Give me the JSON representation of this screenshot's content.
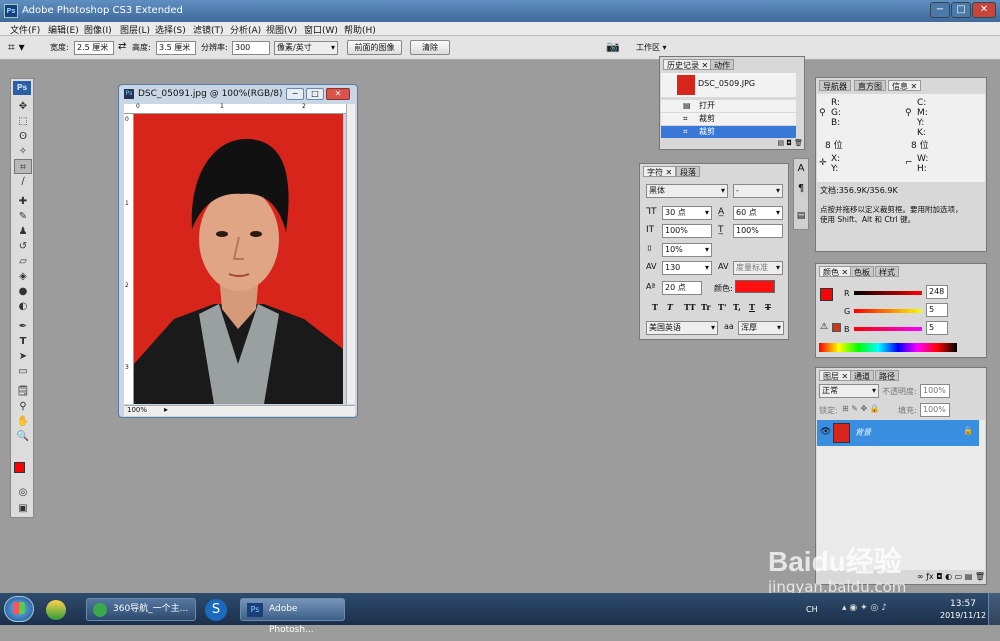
{
  "app": {
    "title": "Adobe Photoshop CS3 Extended",
    "icon": "Ps"
  },
  "menu": [
    "文件(F)",
    "编辑(E)",
    "图像(I)",
    "图层(L)",
    "选择(S)",
    "滤镜(T)",
    "分析(A)",
    "视图(V)",
    "窗口(W)",
    "帮助(H)"
  ],
  "options": {
    "width_label": "宽度:",
    "width_value": "2.5 厘米",
    "height_label": "高度:",
    "height_value": "3.5 厘米",
    "resolution_label": "分辨率:",
    "resolution_value": "300",
    "unit_value": "像素/英寸",
    "front_image_button": "前面的图像",
    "clear_button": "清除",
    "workspace_label": "工作区"
  },
  "document": {
    "title": "DSC_05091.jpg @ 100%(RGB/8)",
    "zoom": "100%",
    "ruler_top": [
      "0",
      "1",
      "2"
    ],
    "ruler_left": [
      "0",
      "1",
      "2",
      "3"
    ],
    "background_color": "#d8251c"
  },
  "history": {
    "tabs": [
      "历史记录",
      "动作"
    ],
    "snapshot": "DSC_0509.JPG",
    "items": [
      "打开",
      "裁剪",
      "裁剪"
    ]
  },
  "character": {
    "tabs": [
      "字符",
      "段落"
    ],
    "font": "黑体",
    "style": "-",
    "size": "30 点",
    "leading": "60 点",
    "vscale": "100%",
    "hscale": "100%",
    "tracking_pct": "10%",
    "kerning": "130",
    "kern_metric": "度量标准",
    "baseline": "20 点",
    "color_label": "颜色:",
    "color": "#ff1010",
    "style_buttons": [
      "T",
      "T",
      "TT",
      "Tr",
      "T'",
      "T,",
      "T",
      "T"
    ],
    "language": "美国英语",
    "aa_label": "aa",
    "antialias": "浑厚"
  },
  "navigator": {
    "tabs": [
      "导航器",
      "直方图",
      "信息"
    ],
    "rgb": [
      "R:",
      "G:",
      "B:"
    ],
    "cmyk": [
      "C:",
      "M:",
      "Y:",
      "K:"
    ],
    "bits_left": "8 位",
    "bits_right": "8 位",
    "xy": [
      "X:",
      "Y:"
    ],
    "wh": [
      "W:",
      "H:"
    ],
    "doc_size": "文档:356.9K/356.9K",
    "hint_line1": "点按并拖移以定义裁剪框。要用附加选项，",
    "hint_line2": "使用 Shift、Alt 和 Ctrl 键。"
  },
  "color_panel": {
    "tabs": [
      "颜色",
      "色板",
      "样式"
    ],
    "channels": [
      {
        "name": "R",
        "value": "248"
      },
      {
        "name": "G",
        "value": "5"
      },
      {
        "name": "B",
        "value": "5"
      }
    ],
    "foreground": "#f80505"
  },
  "layers": {
    "tabs": [
      "图层",
      "通道",
      "路径"
    ],
    "blend": "正常",
    "opacity_label": "不透明度:",
    "opacity": "100%",
    "lock_label": "锁定:",
    "fill_label": "填充:",
    "fill": "100%",
    "layer_name": "背景"
  },
  "taskbar": {
    "task1": "360导航_一个主...",
    "task2": "Adobe Photosh...",
    "time": "13:57",
    "date": "2019/11/12",
    "lang": "CH"
  },
  "watermark": {
    "brand": "Baidu经验",
    "url": "jingyan.baidu.com"
  }
}
